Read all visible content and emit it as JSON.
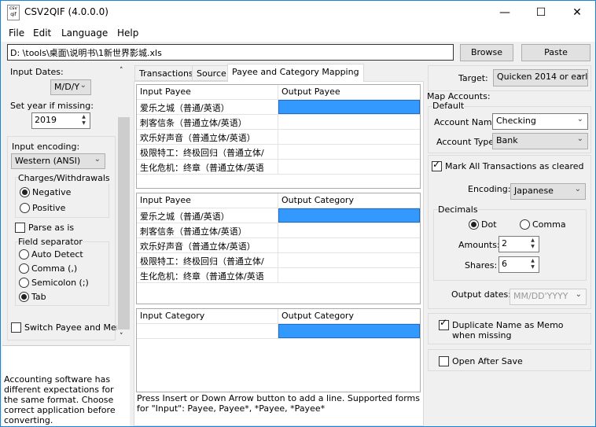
{
  "window": {
    "title": "CSV2QIF (4.0.0.0)",
    "icon_text": "csv qif",
    "min": "—",
    "max": "☐",
    "close": "✕"
  },
  "menu": [
    "File",
    "Edit",
    "Language",
    "Help"
  ],
  "path": {
    "value": "D: \\tools\\桌面\\说明书\\1新世界影城.xls",
    "browse": "Browse",
    "paste": "Paste"
  },
  "left": {
    "input_dates_label": "Input Dates:",
    "date_format": "M/D/Y",
    "year_label": "Set year if missing:",
    "year": "2019",
    "encoding_label": "Input encoding:",
    "encoding": "Western (ANSI)",
    "charges_label": "Charges/Withdrawals",
    "negative": "Negative",
    "positive": "Positive",
    "parse_as_is": "Parse as is",
    "field_sep_label": "Field separator",
    "seps": [
      "Auto Detect",
      "Comma (,)",
      "Semicolon (;)",
      "Tab"
    ],
    "switch_payee": "Switch Payee and Memo",
    "help_text": "Accounting software has different expectations for the same format. Choose correct application before converting."
  },
  "tabs": [
    "Transactions",
    "Source",
    "Payee and Category Mapping"
  ],
  "payee_grid": {
    "headers": [
      "Input Payee",
      "Output Payee"
    ],
    "rows": [
      "爱乐之城（普通/英语）",
      "刺客信条（普通立体/英语）",
      "欢乐好声音（普通立体/英语）",
      "极限特工：终极回归（普通立体/",
      "生化危机：终章（普通立体/英语"
    ]
  },
  "category_grid": {
    "headers": [
      "Input Payee",
      "Output Category"
    ],
    "rows": [
      "爱乐之城（普通/英语）",
      "刺客信条（普通立体/英语）",
      "欢乐好声音（普通立体/英语）",
      "极限特工：终极回归（普通立体/",
      "生化危机：终章（普通立体/英语"
    ]
  },
  "cat_cat_grid": {
    "headers": [
      "Input Category",
      "Output Category"
    ]
  },
  "footer_text": "Press Insert or Down Arrow button to add a line. Supported forms for \"Input\": Payee, Payee*, *Payee, *Payee*",
  "right": {
    "target_label": "Target:",
    "target": "Quicken 2014 or earl",
    "map_accounts": "Map Accounts:",
    "default": "Default",
    "account_name_label": "Account Name:",
    "account_name": "Checking",
    "account_type_label": "Account Type:",
    "account_type": "Bank",
    "mark_cleared": "Mark All Transactions as cleared",
    "encoding_label": "Encoding:",
    "encoding": "Japanese",
    "decimals": "Decimals",
    "dot": "Dot",
    "comma": "Comma",
    "amounts_label": "Amounts:",
    "amounts": "2",
    "shares_label": "Shares:",
    "shares": "6",
    "output_dates_label": "Output dates:",
    "output_dates": "MM/DD'YYYY",
    "dup_name": "Duplicate Name as Memo when missing",
    "open_after": "Open After Save"
  },
  "colors": {
    "selection": "#3399ff",
    "accent": "#1883d7"
  }
}
